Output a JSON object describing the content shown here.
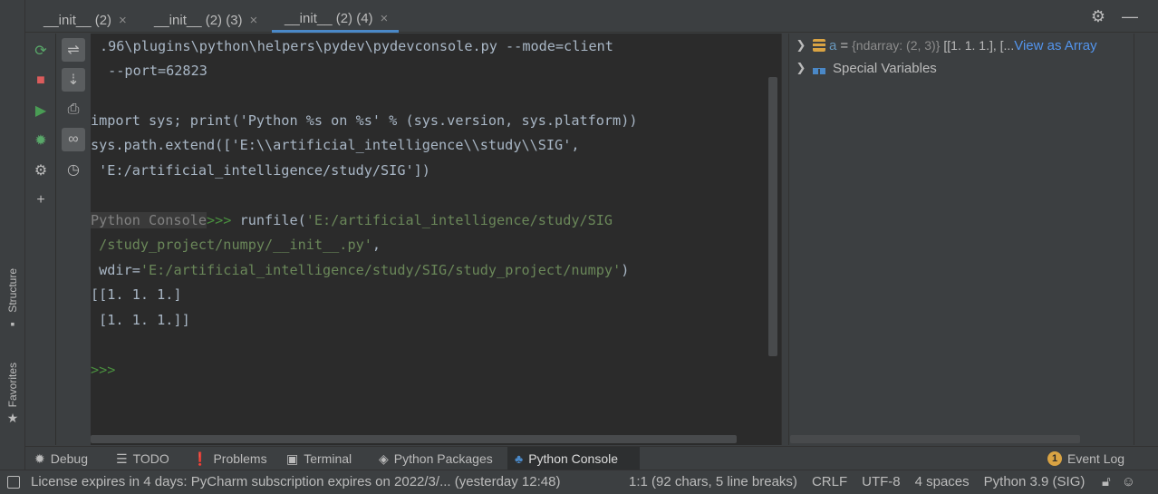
{
  "left_strip": {
    "structure_label": "Structure",
    "structure_icon": "structure-icon",
    "favorites_label": "Favorites",
    "favorites_icon": "star-icon"
  },
  "tabs": [
    {
      "label": "__init__ (2)",
      "active": false
    },
    {
      "label": "__init__ (2) (3)",
      "active": false
    },
    {
      "label": "__init__ (2) (4)",
      "active": true
    }
  ],
  "tab_close_glyph": "×",
  "tabbar_icons": {
    "settings": "⚙",
    "minimize": "—"
  },
  "toolbar_left": [
    {
      "icon": "rerun-icon",
      "glyph": "⟳",
      "color": "#59a869"
    },
    {
      "icon": "stop-icon",
      "glyph": "■",
      "color": "#db5c5c"
    },
    {
      "icon": "run-icon",
      "glyph": "▶",
      "color": "#499c54"
    },
    {
      "icon": "debug-bug-icon",
      "glyph": "✹",
      "color": "#59a869"
    },
    {
      "icon": "settings-gear-icon",
      "glyph": "⚙",
      "color": "#bbbbbb"
    },
    {
      "icon": "add-icon",
      "glyph": "+",
      "color": "#bbbbbb"
    }
  ],
  "toolbar_right": [
    {
      "icon": "soft-wrap-icon",
      "glyph": "⇌",
      "on": true
    },
    {
      "icon": "scroll-to-end-icon",
      "glyph": "⇣",
      "on": true
    },
    {
      "icon": "print-icon",
      "glyph": "⎙",
      "on": false
    },
    {
      "icon": "show-variables-icon",
      "glyph": "∞",
      "on": true
    },
    {
      "icon": "history-clock-icon",
      "glyph": "◷",
      "on": false
    }
  ],
  "console": {
    "l1": ".96\\plugins\\python\\helpers\\pydev\\pydevconsole.py --mode=client",
    "l2": " --port=62823",
    "l3": "import sys; print('Python %s on %s' % (sys.version, sys.platform))",
    "l4": "sys.path.extend(['E:\\\\artificial_intelligence\\\\study\\\\SIG',",
    "l5": " 'E:/artificial_intelligence/study/SIG'])",
    "prompt_label": "Python Console",
    "prompt_arrow": ">>>",
    "l6_cmd": " runfile(",
    "l6_str": "'E:/artificial_intelligence/study/SIG",
    "l7_str": " /study_project/numpy/__init__.py'",
    "l7_rest": ",",
    "l8_kw": " wdir=",
    "l8_str": "'E:/artificial_intelligence/study/SIG/study_project/numpy'",
    "l8_rest": ")",
    "l9": "[[1. 1. 1.]",
    "l10": " [1. 1. 1.]]",
    "final_prompt": ">>>"
  },
  "variables": {
    "row1": {
      "icon": "ndarray-icon",
      "name": "a",
      "eq": "=",
      "type": "{ndarray: (2, 3)}",
      "value": "[[1. 1. 1.], [...",
      "link": "View as Array"
    },
    "row2": {
      "icon": "special-variables-icon",
      "label": "Special Variables"
    }
  },
  "bottom_tabs": [
    {
      "label": "Debug",
      "icon": "debug-icon",
      "glyph": "✹"
    },
    {
      "label": "TODO",
      "icon": "todo-list-icon",
      "glyph": "☰"
    },
    {
      "label": "Problems",
      "icon": "problems-icon",
      "glyph": "❗"
    },
    {
      "label": "Terminal",
      "icon": "terminal-icon",
      "glyph": "▣"
    },
    {
      "label": "Python Packages",
      "icon": "packages-icon",
      "glyph": "◈"
    },
    {
      "label": "Python Console",
      "icon": "python-icon",
      "glyph": "♣"
    }
  ],
  "event_log": {
    "label": "Event Log",
    "badge": "1"
  },
  "status": {
    "message": "License expires in 4 days: PyCharm subscription expires on 2022/3/... (yesterday 12:48)",
    "position": "1:1 (92 chars, 5 line breaks)",
    "line_sep": "CRLF",
    "encoding": "UTF-8",
    "indent": "4 spaces",
    "interpreter": "Python 3.9 (SIG)"
  }
}
